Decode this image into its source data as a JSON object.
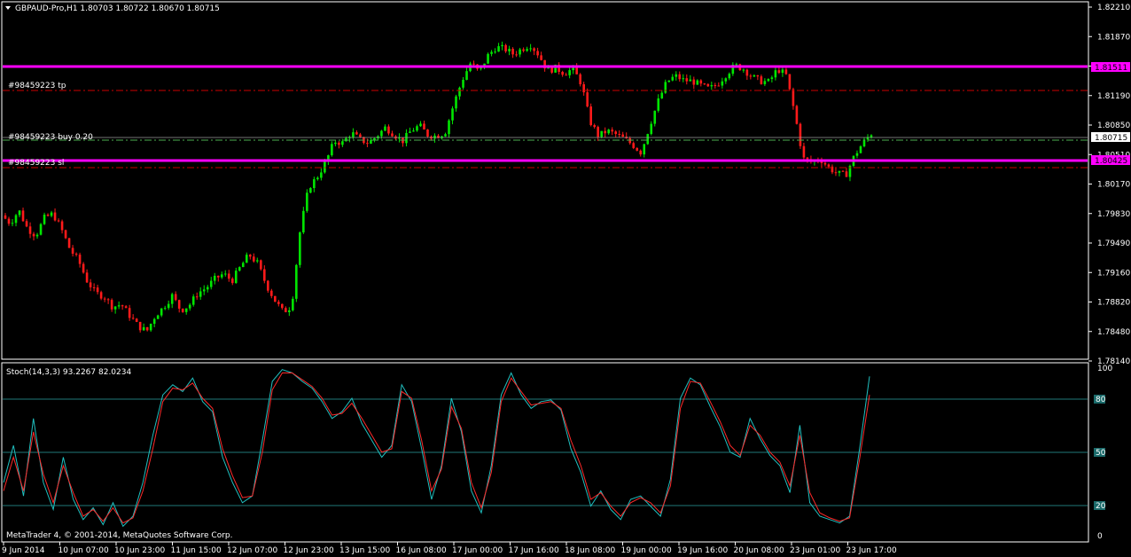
{
  "main_chart": {
    "header": "GBPAUD-Pro,H1  1.80703 1.80722 1.80670 1.80715",
    "price_labels": [
      "1.82210",
      "1.81870",
      "1.81530",
      "1.81190",
      "1.80850",
      "1.80510",
      "1.80170",
      "1.79830",
      "1.79490",
      "1.79160",
      "1.78820",
      "1.78480",
      "1.78140"
    ],
    "order_labels": {
      "tp": "#98459223 tp",
      "buy": "#98459223 buy 0.20",
      "sl": "#98459223 sl"
    },
    "level_tags": {
      "upper": "1.81511",
      "current": "1.80715",
      "lower": "1.80425"
    }
  },
  "indicator": {
    "header": "Stoch(14,3,3) 93.2267 82.0234",
    "scale": [
      "100",
      "80",
      "50",
      "20",
      "0"
    ]
  },
  "footer": {
    "copyright": "MetaTrader 4, © 2001-2014, MetaQuotes Software Corp."
  },
  "time_labels": [
    "9 Jun 2014",
    "10 Jun 07:00",
    "10 Jun 23:00",
    "11 Jun 15:00",
    "12 Jun 07:00",
    "12 Jun 23:00",
    "13 Jun 15:00",
    "16 Jun 08:00",
    "17 Jun 00:00",
    "17 Jun 16:00",
    "18 Jun 08:00",
    "19 Jun 00:00",
    "19 Jun 16:00",
    "20 Jun 08:00",
    "23 Jun 01:00",
    "23 Jun 17:00"
  ],
  "colors": {
    "background": "#000000",
    "bull": "#00e600",
    "bear": "#ff1a1a",
    "level_line": "#ff00ff",
    "order_line": "#cc0000",
    "buy_line": "#4caf50",
    "stoch_main": "#20c0c0",
    "stoch_signal": "#ff2a2a",
    "grid": "#2aa0a0"
  },
  "chart_data": {
    "type": "candlestick",
    "symbol": "GBPAUD-Pro",
    "timeframe": "H1",
    "price_ylim": [
      1.7812,
      1.8222
    ],
    "horizontal_levels": [
      1.81511,
      1.80425
    ],
    "order_levels": {
      "tp": 1.8124,
      "buy": 1.80715,
      "sl": 1.8034
    },
    "close_path": [
      1.7977,
      1.7968,
      1.7983,
      1.7962,
      1.7954,
      1.7974,
      1.7979,
      1.7961,
      1.7938,
      1.7925,
      1.7902,
      1.7888,
      1.7884,
      1.7872,
      1.7875,
      1.7862,
      1.785,
      1.7844,
      1.7862,
      1.7872,
      1.7885,
      1.7868,
      1.7874,
      1.7888,
      1.7894,
      1.7904,
      1.791,
      1.7902,
      1.7918,
      1.7932,
      1.7922,
      1.7898,
      1.788,
      1.7866,
      1.7873,
      1.796,
      1.8009,
      1.8021,
      1.8038,
      1.8062,
      1.806,
      1.8072,
      1.8064,
      1.806,
      1.8068,
      1.8078,
      1.807,
      1.8062,
      1.8074,
      1.808,
      1.8069,
      1.8068,
      1.8072,
      1.8104,
      1.8132,
      1.8152,
      1.8141,
      1.816,
      1.817,
      1.8168,
      1.8162,
      1.8168,
      1.8173,
      1.8161,
      1.8143,
      1.8146,
      1.814,
      1.8145,
      1.8128,
      1.8085,
      1.8068,
      1.8074,
      1.807,
      1.8065,
      1.8058,
      1.8049,
      1.808,
      1.8108,
      1.813,
      1.8137,
      1.8132,
      1.8131,
      1.8126,
      1.8122,
      1.8128,
      1.8139,
      1.8149,
      1.8145,
      1.8136,
      1.8131,
      1.813,
      1.8145,
      1.8138,
      1.8095,
      1.8042,
      1.8038,
      1.8042,
      1.8032,
      1.8025,
      1.8023,
      1.8045,
      1.806,
      1.8071
    ],
    "stochastic": {
      "parameters": "14,3,3",
      "main_value": 93.2267,
      "signal_value": 82.0234,
      "ylim": [
        0,
        100
      ],
      "levels": [
        20,
        50,
        80
      ],
      "main_path": [
        30,
        52,
        22,
        68,
        30,
        14,
        45,
        20,
        8,
        15,
        5,
        18,
        4,
        10,
        30,
        58,
        82,
        88,
        84,
        92,
        78,
        72,
        45,
        30,
        18,
        22,
        55,
        90,
        97,
        95,
        90,
        86,
        78,
        68,
        72,
        80,
        65,
        55,
        45,
        52,
        88,
        78,
        50,
        20,
        40,
        80,
        60,
        25,
        12,
        40,
        82,
        95,
        82,
        74,
        78,
        79,
        73,
        50,
        36,
        16,
        25,
        14,
        8,
        20,
        22,
        16,
        10,
        32,
        80,
        92,
        88,
        75,
        63,
        48,
        45,
        68,
        56,
        46,
        40,
        24,
        64,
        18,
        10,
        8,
        6,
        10,
        50,
        93
      ],
      "signal_path": [
        25,
        45,
        25,
        60,
        35,
        18,
        40,
        24,
        10,
        14,
        7,
        15,
        6,
        9,
        25,
        50,
        78,
        86,
        85,
        89,
        80,
        74,
        50,
        34,
        21,
        22,
        48,
        85,
        95,
        95,
        91,
        87,
        80,
        70,
        71,
        77,
        68,
        58,
        48,
        50,
        84,
        80,
        55,
        25,
        38,
        75,
        62,
        30,
        15,
        36,
        78,
        92,
        84,
        76,
        77,
        78,
        74,
        55,
        40,
        20,
        24,
        16,
        10,
        18,
        21,
        18,
        12,
        28,
        74,
        90,
        89,
        78,
        66,
        52,
        46,
        64,
        58,
        48,
        42,
        28,
        58,
        24,
        12,
        9,
        7,
        9,
        44,
        82
      ]
    }
  }
}
